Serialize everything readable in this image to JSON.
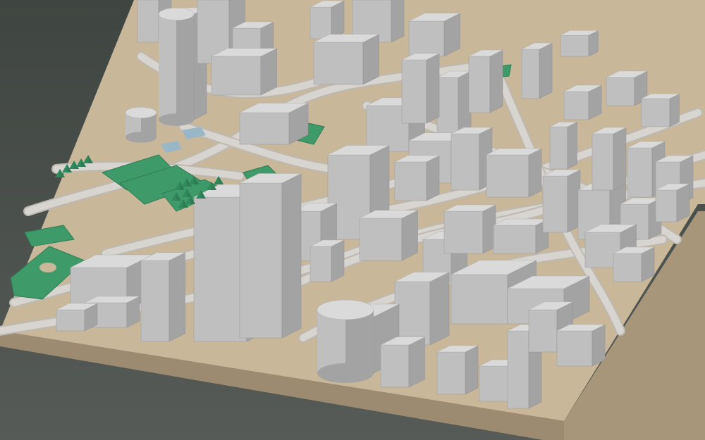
{
  "scene": {
    "colors": {
      "sky_top": "#3f4540",
      "sky_bottom": "#565b57",
      "terrain": "#c9b79a",
      "terrain_side": "#a8967a",
      "terrain_front": "#9c8b70",
      "road": "#d8d5d0",
      "road_edge": "#bdb9b2",
      "building_top": "#dadada",
      "building_left": "#bfbfbf",
      "building_right": "#a3a3a3",
      "park": "#3f9a6a",
      "park_dark": "#2f7d54",
      "tree": "#2f8a5c",
      "water": "#9ab7c8"
    }
  }
}
